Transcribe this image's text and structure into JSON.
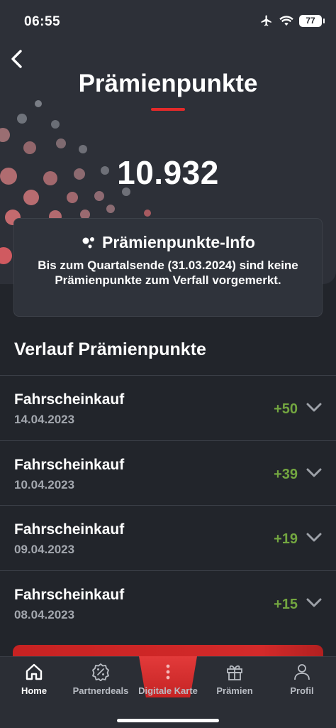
{
  "status": {
    "time": "06:55",
    "battery": "77"
  },
  "header": {
    "title": "Prämienpunkte"
  },
  "points": {
    "total": "10.932"
  },
  "info_card": {
    "title": "Prämienpunkte-Info",
    "text": "Bis zum Quartalsende (31.03.2024) sind keine Prämienpunkte zum Verfall vorgemerkt."
  },
  "history": {
    "title": "Verlauf Prämienpunkte",
    "items": [
      {
        "label": "Fahrscheinkauf",
        "date": "14.04.2023",
        "points": "+50"
      },
      {
        "label": "Fahrscheinkauf",
        "date": "10.04.2023",
        "points": "+39"
      },
      {
        "label": "Fahrscheinkauf",
        "date": "09.04.2023",
        "points": "+19"
      },
      {
        "label": "Fahrscheinkauf",
        "date": "08.04.2023",
        "points": "+15"
      }
    ]
  },
  "tabs": [
    {
      "label": "Home",
      "icon": "home-icon"
    },
    {
      "label": "Partnerdeals",
      "icon": "discount-badge-icon"
    },
    {
      "label": "Digitale Karte",
      "icon": "more-vertical-icon"
    },
    {
      "label": "Prämien",
      "icon": "gift-icon"
    },
    {
      "label": "Profil",
      "icon": "person-icon"
    }
  ],
  "colors": {
    "background": "#22252b",
    "hero": "#2d3038",
    "accent_red": "#e32a2a",
    "points_green": "#73a640",
    "muted_text": "#a3a7ae"
  }
}
